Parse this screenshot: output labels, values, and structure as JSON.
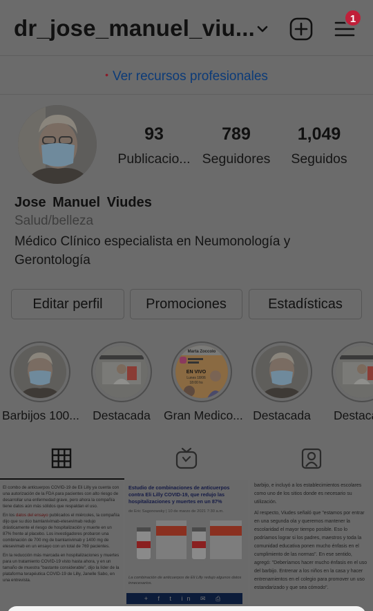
{
  "header": {
    "username": "dr_jose_manuel_viu...",
    "notification_count": "1"
  },
  "professional": {
    "link_label": "Ver recursos profesionales",
    "dot": "•"
  },
  "stats": [
    {
      "value": "93",
      "label": "Publicacio..."
    },
    {
      "value": "789",
      "label": "Seguidores"
    },
    {
      "value": "1,049",
      "label": "Seguidos"
    }
  ],
  "profile": {
    "name": "Jose Manuel Viudes",
    "category": "Salud/belleza",
    "bio": "Médico Clínico especialista en Neumonología y Gerontología"
  },
  "buttons": {
    "edit": "Editar perfil",
    "promotions": "Promociones",
    "stats": "Estadísticas"
  },
  "highlights": [
    {
      "label": "Barbijos 100..."
    },
    {
      "label": "Destacada"
    },
    {
      "label": "Gran Medico..."
    },
    {
      "label": "Destacada"
    },
    {
      "label": "Destaca"
    }
  ],
  "highlight_promo": {
    "top": "Marta Zoccolo",
    "live1": "EN VIVO",
    "live2": "Lunes 18/06",
    "live3": "18:00 hs"
  },
  "tabs": [
    "grid-icon",
    "igtv-icon",
    "tagged-icon"
  ],
  "posts": {
    "post1": {
      "p1": "El combo de anticuerpos COVID-19 de Eli Lilly ya cuenta con una autorización de la FDA para pacientes con alto riesgo de desarrollar una enfermedad grave, pero ahora la compañía tiene datos aún más sólidos que respaldan el uso.",
      "p2a": "En los ",
      "p2red": "datos del ensayo",
      "p2b": " publicados el miércoles, la compañía dijo que su dúo bamlanivimab-etesevimab redujo drásticamente el riesgo de hospitalización y muerte en un 87% frente al placebo. Los investigadores probaron una combinación de 700 mg de bamlanivimab y 1400 mg de etesevimab en un ensayo con un total de 769 pacientes.",
      "p3": "En la reducción más marcada en hospitalizaciones y muertes para un tratamiento COVID-19 visto hasta ahora, y en un tamaño de muestra \"bastante considerable\", dijo la líder de la plataforma terapéutica COVID-19 de Lilly, Janelle Sabo, en una entrevista."
    },
    "post2": {
      "title": "Estudio de combinaciones de anticuerpos contra Eli Lilly COVID-19, que redujo las hospitalizaciones y muertes en un 87%",
      "meta": "de Eric Sagonowsky | 10 de marzo de 2021 7:30 a.m.",
      "caption": "La combinación de anticuerpos de Eli Lilly redujo algunos datos innecesarios.",
      "share": "+ f t in ✉ ⎙"
    },
    "post3": {
      "p1": "barbijo, e incluyó a los establecimientos escolares como uno de los sitios donde es necesario su utilización.",
      "p2": "Al respecto, Viudes señaló que \"estamos por entrar en una segunda ola y queremos mantener la escolaridad el mayor tiempo posible. Eso lo podríamos lograr si los padres, maestros y toda la comunidad educativa ponen mucho énfasis en el cumplimiento de las normas\". En ese sentido, agregó: \"Deberíamos hacer mucho énfasis en el uso del barbijo. Entrenar a los niños en la casa y hacer entrenamientos en el colegio para promover un uso estandarizado y que sea cómodo\"."
    }
  }
}
